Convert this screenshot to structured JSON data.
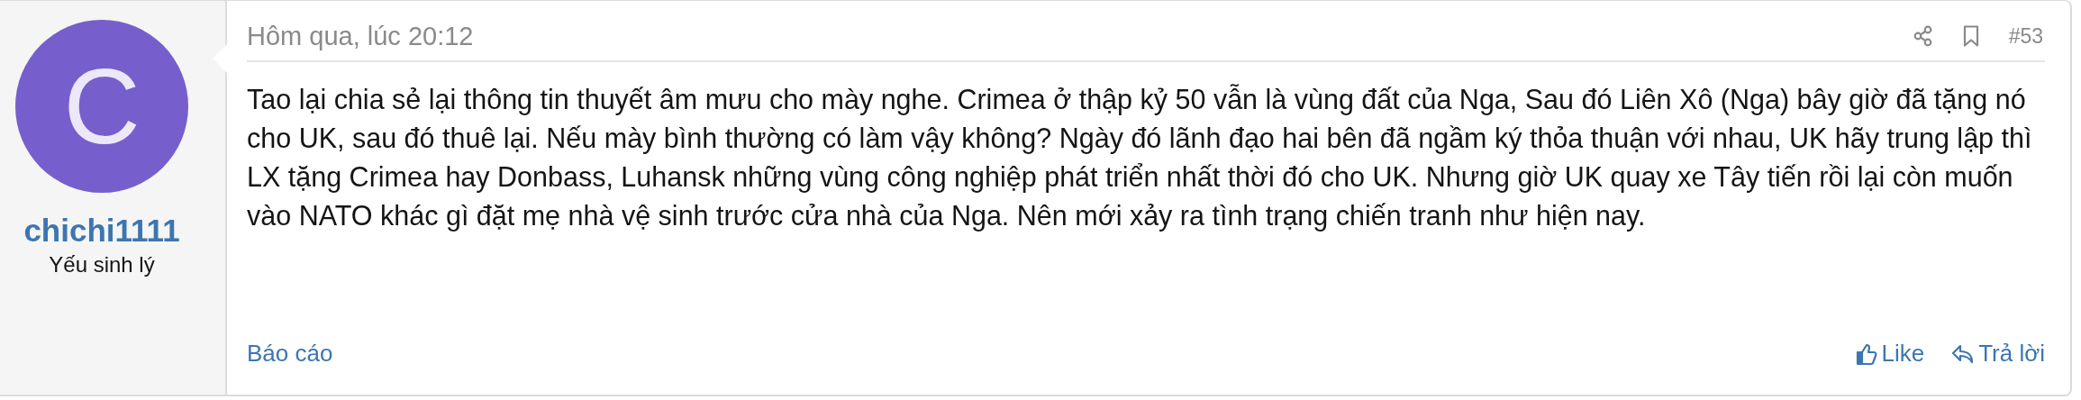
{
  "user": {
    "avatar_letter": "C",
    "name": "chichi1111",
    "title": "Yếu sinh lý"
  },
  "post": {
    "date": "Hôm qua, lúc 20:12",
    "number": "#53",
    "body": "Tao lại chia sẻ lại thông tin thuyết âm mưu cho mày nghe. Crimea ở thập kỷ 50 vẫn là vùng đất của Nga, Sau đó Liên Xô (Nga) bây giờ đã tặng nó cho UK, sau đó thuê lại. Nếu mày bình thường có làm vậy không? Ngày đó lãnh đạo hai bên đã ngầm ký thỏa thuận với nhau, UK hãy trung lập thì LX tặng Crimea hay Donbass, Luhansk những vùng công nghiệp phát triển nhất thời đó cho UK. Nhưng giờ UK quay xe Tây tiến rồi lại còn muốn vào NATO khác gì đặt mẹ nhà vệ sinh trước cửa nhà của Nga. Nên mới xảy ra tình trạng chiến tranh như hiện nay.",
    "report": "Báo cáo",
    "like": "Like",
    "reply": "Trả lời"
  }
}
